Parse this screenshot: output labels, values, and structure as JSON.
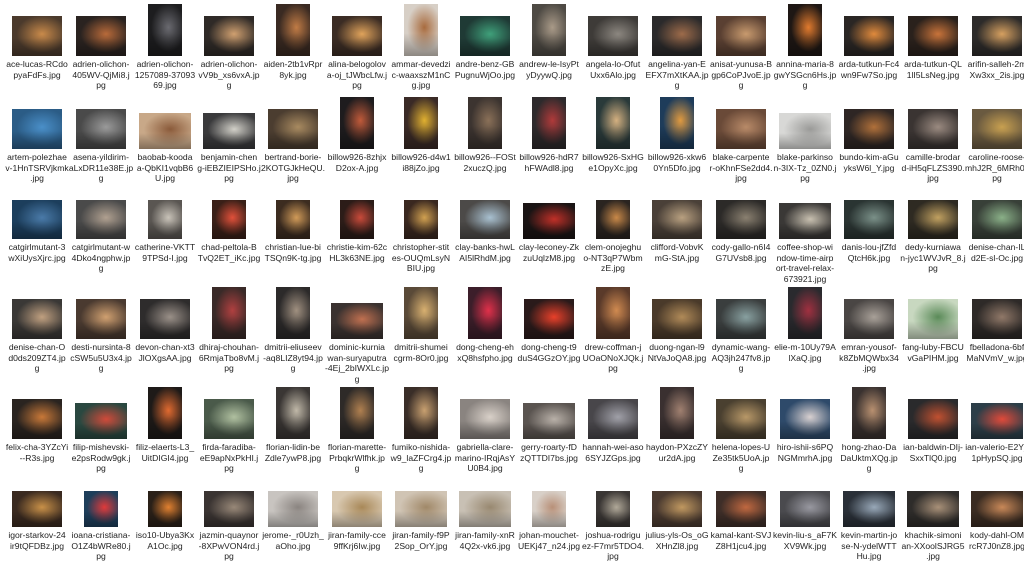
{
  "files": [
    {
      "name": "ace-lucas-RCdo\npyaFdFs.jpg",
      "color": "#4b3a2c",
      "accent": "#c98a4a"
    },
    {
      "name": "adrien-olichon-\n405WV-QjMi8.j\npg",
      "color": "#2a2320",
      "accent": "#b86a3a"
    },
    {
      "name": "adrien-olichon-\n1257089-37093\n69.jpg",
      "color": "#1d1d1f",
      "accent": "#6a6a70"
    },
    {
      "name": "adrien-olichon-\nvV9b_xs6vxA.jp\ng",
      "color": "#2f2a27",
      "accent": "#d0a070"
    },
    {
      "name": "aiden-2tb1vRpr\n8yk.jpg",
      "color": "#3a2a22",
      "accent": "#c07b45"
    },
    {
      "name": "alina-belogolov\na-oj_tJWbcLfw.j\npg",
      "color": "#3b2c24",
      "accent": "#e0a35b"
    },
    {
      "name": "ammar-devedzi\nc-waaxszM1nC\ng.jpg",
      "color": "#d7cfc6",
      "accent": "#a86b3e"
    },
    {
      "name": "andre-benz-GB\nPugnuWjOo.jpg",
      "color": "#1f3a35",
      "accent": "#3fa07a"
    },
    {
      "name": "andrew-le-IsyPt\nyDyywQ.jpg",
      "color": "#4e4a44",
      "accent": "#a99a88"
    },
    {
      "name": "angela-lo-Ofut\nUxx6Alo.jpg",
      "color": "#3e3b38",
      "accent": "#8c8780"
    },
    {
      "name": "angelina-yan-E\nEFX7mXtKAA.jp\ng",
      "color": "#2b2a2b",
      "accent": "#9d6b4a"
    },
    {
      "name": "anisat-yunusa-B\ngp6CoPJvoE.jp\ng",
      "color": "#5a4032",
      "accent": "#c89a6e"
    },
    {
      "name": "annina-maria-8\ngwYSGcn6Hs.jp\ng",
      "color": "#1e1714",
      "accent": "#e07a2e"
    },
    {
      "name": "arda-tutkun-Fc4\nwn9Fw7So.jpg",
      "color": "#2a2624",
      "accent": "#e08a3c"
    },
    {
      "name": "arda-tutkun-QL\n1lI5LsNeg.jpg",
      "color": "#2a211c",
      "accent": "#c8733a"
    },
    {
      "name": "arifin-salleh-2m\nXw3xx_2is.jpg",
      "color": "#2d2b2a",
      "accent": "#d6a060"
    },
    {
      "name": "artem-polezhae\nv-1HnTSRVjkmk\n.jpg",
      "color": "#2b5c86",
      "accent": "#4a8fc8"
    },
    {
      "name": "asena-yildirim-\naLxDR11e38E.jp\ng",
      "color": "#4a4a4a",
      "accent": "#9a9a9a"
    },
    {
      "name": "baobab-kooda\na-QbKI1vqbB6\nU.jpg",
      "color": "#c8a888",
      "accent": "#8a5a3a"
    },
    {
      "name": "benjamin-chen\ng-iEBZIEIPSHo.j\npg",
      "color": "#3a3a3c",
      "accent": "#d2d0c8"
    },
    {
      "name": "bertrand-borie-\n2KOTGJkHeQU.\njpg",
      "color": "#4b3d30",
      "accent": "#a88a60"
    },
    {
      "name": "billow926-8zhjx\nD2ox-A.jpg",
      "color": "#1e1c1e",
      "accent": "#c05a3a"
    },
    {
      "name": "billow926-d4w1\ni88jZo.jpg",
      "color": "#3a2a26",
      "accent": "#e0b030"
    },
    {
      "name": "billow926--FOSt\n2xuczQ.jpg",
      "color": "#3c3430",
      "accent": "#8a7058"
    },
    {
      "name": "billow926-hdR7\nhFWAdl8.jpg",
      "color": "#2e2a2c",
      "accent": "#b03a3a"
    },
    {
      "name": "billow926-SxHG\ne1OpyXc.jpg",
      "color": "#2a3a3a",
      "accent": "#d4b080"
    },
    {
      "name": "billow926-xkw6\n0Yn5Dfo.jpg",
      "color": "#1e3c5a",
      "accent": "#e09a40"
    },
    {
      "name": "blake-carpente\nr-oKhnFSe2dd4.\njpg",
      "color": "#6a4a38",
      "accent": "#b88a68"
    },
    {
      "name": "blake-parkinso\nn-3IX-Tz_0ZN0.j\npg",
      "color": "#d8d8d6",
      "accent": "#9a9a98"
    },
    {
      "name": "bundo-kim-aGu\nyksW6l_Y.jpg",
      "color": "#2e2624",
      "accent": "#b0703a"
    },
    {
      "name": "camille-brodar\nd-iH5qFLZS390.\njpg",
      "color": "#3a3432",
      "accent": "#9a8a80"
    },
    {
      "name": "caroline-roose-\nmhJ2R_6MRh0.j\npg",
      "color": "#6a5a40",
      "accent": "#c8a050"
    },
    {
      "name": "catgirlmutant-3\nwXiUysXjrc.jpg",
      "color": "#1c3e5c",
      "accent": "#4a7aa8"
    },
    {
      "name": "catgirlmutant-w\n4Dko4ngphw.jp\ng",
      "color": "#4a4a4a",
      "accent": "#b0a090"
    },
    {
      "name": "catherine-VKTT\n9TPSd-I.jpg",
      "color": "#5a5652",
      "accent": "#c8c2b8"
    },
    {
      "name": "chad-peltola-B\nTvQ2ET_iKc.jpg",
      "color": "#3a2018",
      "accent": "#e0503a"
    },
    {
      "name": "christian-lue-bi\nTSQn9K-tg.jpg",
      "color": "#3c2c20",
      "accent": "#d09a58"
    },
    {
      "name": "christie-kim-62c\nHL3k63NE.jpg",
      "color": "#2c1c18",
      "accent": "#c84a3a"
    },
    {
      "name": "christopher-stit\nes-OUQmLsyN\nBIU.jpg",
      "color": "#3a2820",
      "accent": "#d0a050"
    },
    {
      "name": "clay-banks-hwL\nAI5lRhdM.jpg",
      "color": "#4c4a48",
      "accent": "#a8c0d0"
    },
    {
      "name": "clay-leconey-Zk\nzuUqlzM8.jpg",
      "color": "#1a1414",
      "accent": "#c03028"
    },
    {
      "name": "clem-onojeghu\no-NT3qP7Wbm\nzE.jpg",
      "color": "#2a2420",
      "accent": "#c88848"
    },
    {
      "name": "clifford-VobvK\nmG-StA.jpg",
      "color": "#4a4038",
      "accent": "#b8a080"
    },
    {
      "name": "cody-gallo-n6I4\nG7UVsb8.jpg",
      "color": "#2c2a28",
      "accent": "#8a8070"
    },
    {
      "name": "coffee-shop-wi\nndow-time-airp\nort-travel-relax-\n673921.jpg",
      "color": "#3a3836",
      "accent": "#c8c0b0"
    },
    {
      "name": "danis-lou-jfZfd\nQtcH6k.jpg",
      "color": "#2a3432",
      "accent": "#7a9088"
    },
    {
      "name": "dedy-kurniawa\nn-jyc1WVJvR_8.j\npg",
      "color": "#2e2a22",
      "accent": "#c0a060"
    },
    {
      "name": "denise-chan-IL\nd2E-sl-Oc.jpg",
      "color": "#384038",
      "accent": "#8ab088"
    },
    {
      "name": "denise-chan-O\nd0ds209ZT4.jp\ng",
      "color": "#3a3836",
      "accent": "#c0a080"
    },
    {
      "name": "desti-nursinta-8\ncSW5u5U3x4.jp\ng",
      "color": "#4a3a30",
      "accent": "#d0a070"
    },
    {
      "name": "devon-chan-xt3\nJlOXgsAA.jpg",
      "color": "#2e2c2c",
      "accent": "#9a9088"
    },
    {
      "name": "dhiraj-chouhan-\n6RmjaTbo8vM.j\npg",
      "color": "#3a2a28",
      "accent": "#b04040"
    },
    {
      "name": "dmitrii-eliuseev\n-aq8LIZ8yt94.jp\ng",
      "color": "#2c2a2a",
      "accent": "#a09080"
    },
    {
      "name": "dominic-kurnia\nwan-suryaputra\n-4Ej_2bIWXLc.jp\ng",
      "color": "#3a3230",
      "accent": "#c07050"
    },
    {
      "name": "dmitrii-shumei\ncgrm-8Or0.jpg",
      "color": "#5a4a38",
      "accent": "#d8b070"
    },
    {
      "name": "dong-cheng-eh\nxQ8hsfpho.jpg",
      "color": "#3c1e2a",
      "accent": "#e0304a"
    },
    {
      "name": "dong-cheng-t9\nduS4GGzOY.jpg",
      "color": "#2a1a1a",
      "accent": "#e8402a"
    },
    {
      "name": "drew-coffman-j\nUOaONoXJQk.j\npg",
      "color": "#5a3a2a",
      "accent": "#d08a50"
    },
    {
      "name": "duong-ngan-l9\nNtVaJoQA8.jpg",
      "color": "#4a3a2a",
      "accent": "#b08a58"
    },
    {
      "name": "dynamic-wang-\nAQ3jh247fv8.jp\ng",
      "color": "#3a3e3e",
      "accent": "#88a0a0"
    },
    {
      "name": "elie-m-10Uy79A\nlXaQ.jpg",
      "color": "#2a2a2e",
      "accent": "#a03040"
    },
    {
      "name": "emran-yousof-\nk8ZbMQWbx34\n.jpg",
      "color": "#4a4644",
      "accent": "#a8a098"
    },
    {
      "name": "fang-luby-FBCU\nvGaPIHM.jpg",
      "color": "#c8d8c0",
      "accent": "#5a8a58"
    },
    {
      "name": "fbelladona-6bf\nMaNVmV_w.jpg",
      "color": "#2e2a28",
      "accent": "#907868"
    },
    {
      "name": "felix-cha-3YZcYi\n--R3s.jpg",
      "color": "#2a2420",
      "accent": "#c87838"
    },
    {
      "name": "filip-mishevski-\ne2psRodw9gk.j\npg",
      "color": "#2a4840",
      "accent": "#d04a3a"
    },
    {
      "name": "filiz-elaerts-L3_\nUitDIGI4.jpg",
      "color": "#1e1a18",
      "accent": "#e06a30"
    },
    {
      "name": "firda-faradiba-\neE9apNxPkHI.j\npg",
      "color": "#4a5a4a",
      "accent": "#b0c0a0"
    },
    {
      "name": "florian-lidin-be\nZdle7ywP8.jpg",
      "color": "#3a3634",
      "accent": "#c0b8a8"
    },
    {
      "name": "florian-marette-\nPrbqkrWlfhk.jp\ng",
      "color": "#2e2a28",
      "accent": "#b08050"
    },
    {
      "name": "fumiko-nishida-\nw9_laZFCrg4.jp\ng",
      "color": "#3a2e28",
      "accent": "#c8a070"
    },
    {
      "name": "gabriella-clare-\nmarino-IRqjAsY\nU0B4.jpg",
      "color": "#8a8480",
      "accent": "#d8d0c8"
    },
    {
      "name": "gerry-roarty-fD\nzQTTDI7bs.jpg",
      "color": "#5a5450",
      "accent": "#b8b0a8"
    },
    {
      "name": "hannah-wei-aso\n6SYJZGps.jpg",
      "color": "#48464a",
      "accent": "#a0a0a8"
    },
    {
      "name": "haydon-PXzcZY\nur2dA.jpg",
      "color": "#3a3030",
      "accent": "#a08070"
    },
    {
      "name": "helena-lopes-U\nZe35tk5UoA.jp\ng",
      "color": "#4a4030",
      "accent": "#b89868"
    },
    {
      "name": "hiro-ishii-s6PQ\nNGMmrhA.jpg",
      "color": "#2e4a6a",
      "accent": "#d8d0d0"
    },
    {
      "name": "hong-zhao-Da\nDaUktmXQg.jp\ng",
      "color": "#3a3230",
      "accent": "#b89070"
    },
    {
      "name": "ian-baldwin-DIj-\nSxxTlQ0.jpg",
      "color": "#2a2a2c",
      "accent": "#c05030"
    },
    {
      "name": "ian-valerio-E2Y_\n1pHypSQ.jpg",
      "color": "#2c3e48",
      "accent": "#e04a3a"
    },
    {
      "name": "igor-starkov-24\nir9tQFDBz.jpg",
      "color": "#3a2a20",
      "accent": "#c89048"
    },
    {
      "name": "ioana-cristiana-\nO1Z4bWRe80.j\npg",
      "color": "#1e3e5a",
      "accent": "#e03a3a"
    },
    {
      "name": "iso10-Ubya3Kx\nA1Oc.jpg",
      "color": "#2a2018",
      "accent": "#e08030"
    },
    {
      "name": "jazmin-quaynor\n-8XPwVON4rd.j\npg",
      "color": "#3a3432",
      "accent": "#988878"
    },
    {
      "name": "jerome-_r0Uzh_\naOho.jpg",
      "color": "#c8c4c0",
      "accent": "#8a8480"
    },
    {
      "name": "jiran-family-cce\n9ffKrj6Iw.jpg",
      "color": "#d8c8b0",
      "accent": "#a88858"
    },
    {
      "name": "jiran-family-f9P\n2Sop_OrY.jpg",
      "color": "#d0c4b4",
      "accent": "#a08868"
    },
    {
      "name": "jiran-family-xnR\n4Q2x-vk6.jpg",
      "color": "#c8c0b4",
      "accent": "#988870"
    },
    {
      "name": "johan-mouchet-\nUEKj47_n24.jpg",
      "color": "#d8d0c8",
      "accent": "#b89078"
    },
    {
      "name": "joshua-rodrigu\nez-F7mr5TDO4.\njpg",
      "color": "#3a3634",
      "accent": "#b0a898"
    },
    {
      "name": "julius-yls-Os_oG\nXHnZl8.jpg",
      "color": "#4a3a30",
      "accent": "#c09860"
    },
    {
      "name": "kamal-kant-SVJ\nZ8H1jcu4.jpg",
      "color": "#3e2e28",
      "accent": "#c06840"
    },
    {
      "name": "kevin-liu-s_aF7K\nXV9Wk.jpg",
      "color": "#4a4a4e",
      "accent": "#9898a0"
    },
    {
      "name": "kevin-martin-jo\nse-N-ydelWTT\nHu.jpg",
      "color": "#2a3038",
      "accent": "#98a8b8"
    },
    {
      "name": "khachik-simoni\nan-XXoolSJRG5\n.jpg",
      "color": "#2e2c2a",
      "accent": "#a89078"
    },
    {
      "name": "kody-dahl-OM\nrcR7J0nZ8.jpg",
      "color": "#3a2c22",
      "accent": "#c88858"
    }
  ]
}
